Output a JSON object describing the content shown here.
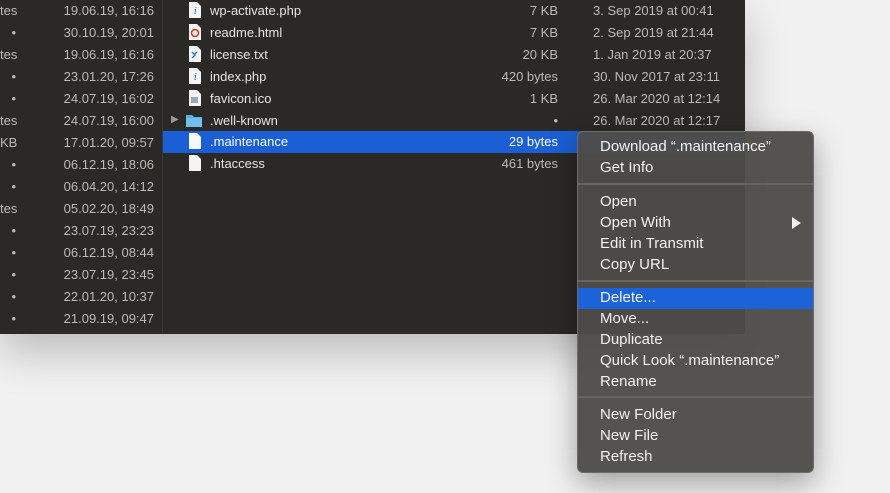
{
  "left_rows": [
    {
      "size": "tes",
      "date": "19.06.19, 16:16"
    },
    {
      "size": "•",
      "date": "30.10.19, 20:01"
    },
    {
      "size": "tes",
      "date": "19.06.19, 16:16"
    },
    {
      "size": "•",
      "date": "23.01.20, 17:26"
    },
    {
      "size": "•",
      "date": "24.07.19, 16:02"
    },
    {
      "size": "tes",
      "date": "24.07.19, 16:00"
    },
    {
      "size": "KB",
      "date": "17.01.20, 09:57"
    },
    {
      "size": "•",
      "date": "06.12.19, 18:06"
    },
    {
      "size": "•",
      "date": "06.04.20, 14:12"
    },
    {
      "size": "tes",
      "date": "05.02.20, 18:49"
    },
    {
      "size": "•",
      "date": "23.07.19, 23:23"
    },
    {
      "size": "•",
      "date": "06.12.19, 08:44"
    },
    {
      "size": "•",
      "date": "23.07.19, 23:45"
    },
    {
      "size": "•",
      "date": "22.01.20, 10:37"
    },
    {
      "size": "•",
      "date": "21.09.19, 09:47"
    }
  ],
  "files": [
    {
      "name": "wp-activate.php",
      "size": "7 KB",
      "date": "3. Sep 2019 at 00:41",
      "icon": "php-file-icon"
    },
    {
      "name": "readme.html",
      "size": "7 KB",
      "date": "2. Sep 2019 at 21:44",
      "icon": "html-file-icon"
    },
    {
      "name": "license.txt",
      "size": "20 KB",
      "date": "1. Jan 2019 at 20:37",
      "icon": "text-file-icon"
    },
    {
      "name": "index.php",
      "size": "420 bytes",
      "date": "30. Nov 2017 at 23:11",
      "icon": "php-file-icon"
    },
    {
      "name": "favicon.ico",
      "size": "1 KB",
      "date": "26. Mar 2020 at 12:14",
      "icon": "image-file-icon"
    },
    {
      "name": ".well-known",
      "size": "•",
      "date": "26. Mar 2020 at 12:17",
      "icon": "folder-icon"
    },
    {
      "name": ".maintenance",
      "size": "29 bytes",
      "date": "",
      "icon": "blank-file-icon"
    },
    {
      "name": ".htaccess",
      "size": "461 bytes",
      "date": "",
      "icon": "blank-file-icon"
    }
  ],
  "menu": {
    "download": "Download “.maintenance”",
    "get_info": "Get Info",
    "open": "Open",
    "open_with": "Open With",
    "edit_in_transmit": "Edit in Transmit",
    "copy_url": "Copy URL",
    "delete": "Delete...",
    "move": "Move...",
    "duplicate": "Duplicate",
    "quick_look": "Quick Look “.maintenance”",
    "rename": "Rename",
    "new_folder": "New Folder",
    "new_file": "New File",
    "refresh": "Refresh"
  },
  "colors": {
    "selection": "#1a5fd6",
    "menu_highlight": "#1d63d8"
  }
}
